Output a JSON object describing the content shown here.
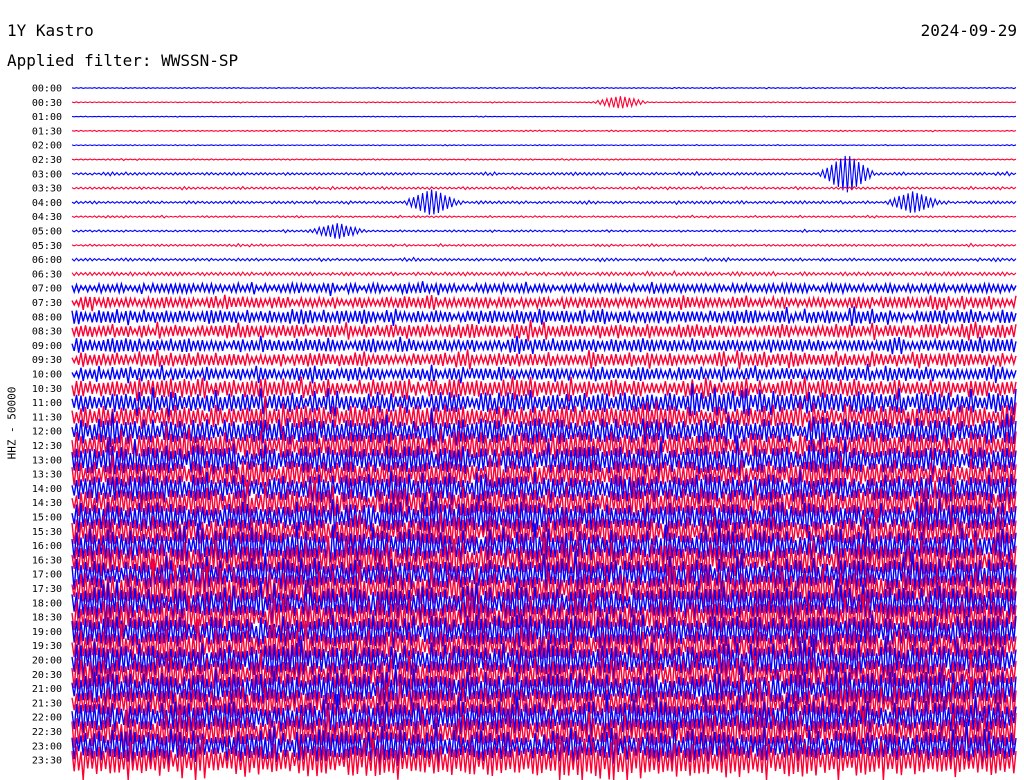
{
  "header": {
    "station": "1Y Kastro",
    "date": "2024-09-29",
    "filter": "Applied filter: WWSSN-SP"
  },
  "chart_data": {
    "type": "line",
    "title": "1Y Kastro",
    "subtitle": "Applied filter: WWSSN-SP",
    "date": "2024-09-29",
    "ylabel": "HHZ - 50000",
    "xlabel": "",
    "grid": false,
    "trace_times": [
      "00:00",
      "00:30",
      "01:00",
      "01:30",
      "02:00",
      "02:30",
      "03:00",
      "03:30",
      "04:00",
      "04:30",
      "05:00",
      "05:30",
      "06:00",
      "06:30",
      "07:00",
      "07:30",
      "08:00",
      "08:30",
      "09:00",
      "09:30",
      "10:00",
      "10:30",
      "11:00",
      "11:30",
      "12:00",
      "12:30",
      "13:00",
      "13:30",
      "14:00",
      "14:30",
      "15:00",
      "15:30",
      "16:00",
      "16:30",
      "17:00",
      "17:30",
      "18:00",
      "18:30",
      "19:00",
      "19:30",
      "20:00",
      "20:30",
      "21:00",
      "21:30",
      "22:00",
      "22:30",
      "23:00",
      "23:30"
    ],
    "series_colors": [
      "#0000ff",
      "#ff0033"
    ],
    "relative_amplitude": [
      0.4,
      0.4,
      0.3,
      0.5,
      0.4,
      0.5,
      1.2,
      1.0,
      1.2,
      0.8,
      0.8,
      0.9,
      1.2,
      1.6,
      4,
      5,
      6,
      6,
      6,
      6,
      6,
      8,
      9,
      10,
      11,
      12,
      12,
      12,
      12,
      13,
      13,
      13,
      14,
      14,
      14,
      14,
      14,
      14,
      14,
      14,
      14,
      14,
      14,
      14,
      14,
      14,
      14,
      14
    ],
    "events": [
      {
        "time": "00:30",
        "offset": 0.58,
        "amplitude": 6
      },
      {
        "time": "03:00",
        "offset": 0.82,
        "amplitude": 18
      },
      {
        "time": "04:00",
        "offset": 0.38,
        "amplitude": 12
      },
      {
        "time": "04:00",
        "offset": 0.89,
        "amplitude": 10
      },
      {
        "time": "05:00",
        "offset": 0.28,
        "amplitude": 7
      }
    ]
  }
}
